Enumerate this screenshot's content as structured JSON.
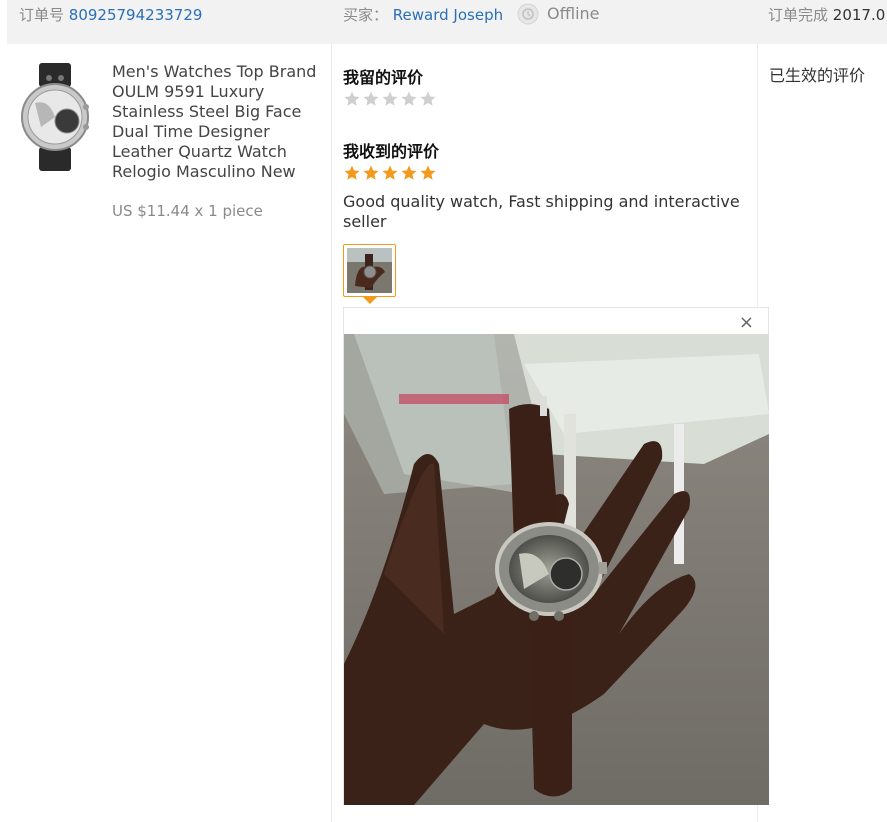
{
  "header": {
    "order_label": "订单号",
    "order_number": "80925794233729",
    "buyer_label": "买家：",
    "buyer_name": "Reward Joseph",
    "status": "Offline",
    "completed_label": "订单完成",
    "completed_date": "2017.0"
  },
  "product": {
    "title": "Men's Watches Top Brand OULM 9591 Luxury Stainless Steel Big Face Dual Time Designer Leather Quartz Watch Relogio Masculino New",
    "price": "US $11.44 x 1 piece"
  },
  "feedback": {
    "left_heading": "我留的评价",
    "left_rating": 0,
    "received_heading": "我收到的评价",
    "received_rating": 5,
    "review_text": "Good quality watch, Fast shipping and interactive seller",
    "star_color_on": "#f39a1c",
    "star_color_off": "#cfcfcf"
  },
  "preview": {
    "close_label": "×"
  },
  "side": {
    "effective_label": "已生效的评价"
  },
  "colors": {
    "link": "#2a6fb8",
    "accent": "#f39a1c",
    "header_bg": "#f2f2f2"
  }
}
